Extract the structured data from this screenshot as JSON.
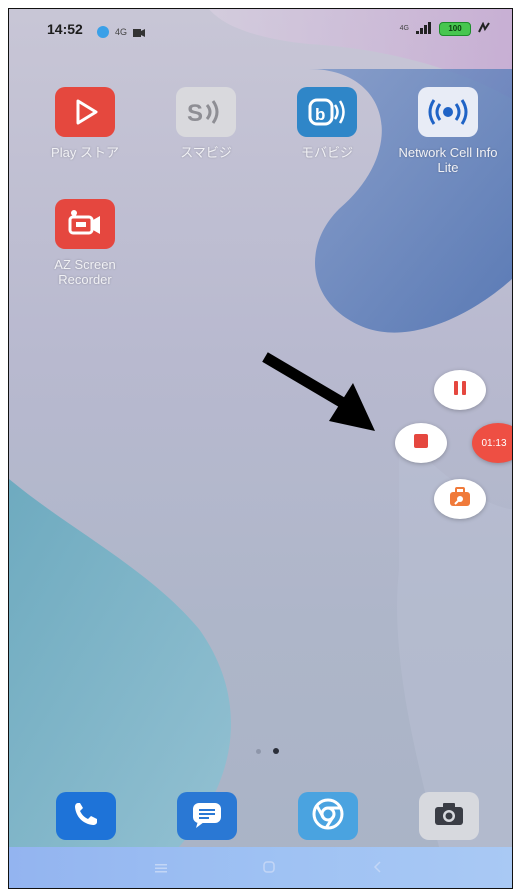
{
  "status_bar": {
    "time": "14:52",
    "network_label": "4G",
    "signal_label": "4G",
    "battery_level": "100"
  },
  "apps": [
    {
      "label": "Play ストア",
      "icon": "play-store-icon"
    },
    {
      "label": "スマビジ",
      "icon": "sumabiji-icon"
    },
    {
      "label": "モバビジ",
      "icon": "mobabiji-icon"
    },
    {
      "label": "Network Cell Info Lite",
      "icon": "network-cell-icon"
    },
    {
      "label": "AZ Screen Recorder",
      "icon": "az-recorder-icon"
    }
  ],
  "recorder": {
    "timer": "01:13"
  },
  "dock": [
    {
      "icon": "phone-icon"
    },
    {
      "icon": "messages-icon"
    },
    {
      "icon": "chrome-icon"
    },
    {
      "icon": "camera-icon"
    }
  ],
  "colors": {
    "play_red": "#e5483e",
    "recorder_red": "#e5473f",
    "wallpaper_blue": "#5479b4",
    "wallpaper_teal": "#5a9eb6",
    "recorder_orange": "#f07a3a",
    "navbar_blue": "#9ec1f3"
  },
  "icons": {
    "recording_indicator": "video-camera-icon",
    "pointer": "arrow-icon",
    "pause": "pause-icon",
    "stop": "stop-icon",
    "tools": "toolbox-icon",
    "nav_menu": "menu-icon",
    "nav_home": "home-icon",
    "nav_back": "back-icon"
  }
}
